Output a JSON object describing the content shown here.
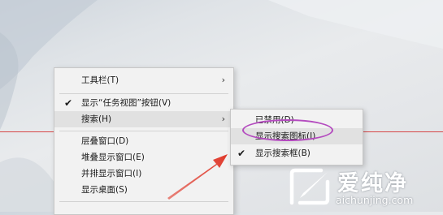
{
  "context_menu": {
    "items": [
      {
        "label": "工具栏(T)"
      },
      {
        "label": "显示“任务视图”按钮(V)"
      },
      {
        "label": "搜索(H)"
      },
      {
        "label": "层叠窗口(D)"
      },
      {
        "label": "堆叠显示窗口(E)"
      },
      {
        "label": "并排显示窗口(I)"
      },
      {
        "label": "显示桌面(S)"
      }
    ]
  },
  "search_submenu": {
    "items": [
      {
        "label": "已禁用(D)"
      },
      {
        "label": "显示搜索图标(I)"
      },
      {
        "label": "显示搜索框(B)"
      }
    ]
  },
  "watermark": {
    "title": "爱纯净",
    "url": "aichunjing.com"
  },
  "colors": {
    "highlight_ellipse": "#b44bbf",
    "arrow": "#e0392b",
    "guide_line": "#d42a2a"
  }
}
